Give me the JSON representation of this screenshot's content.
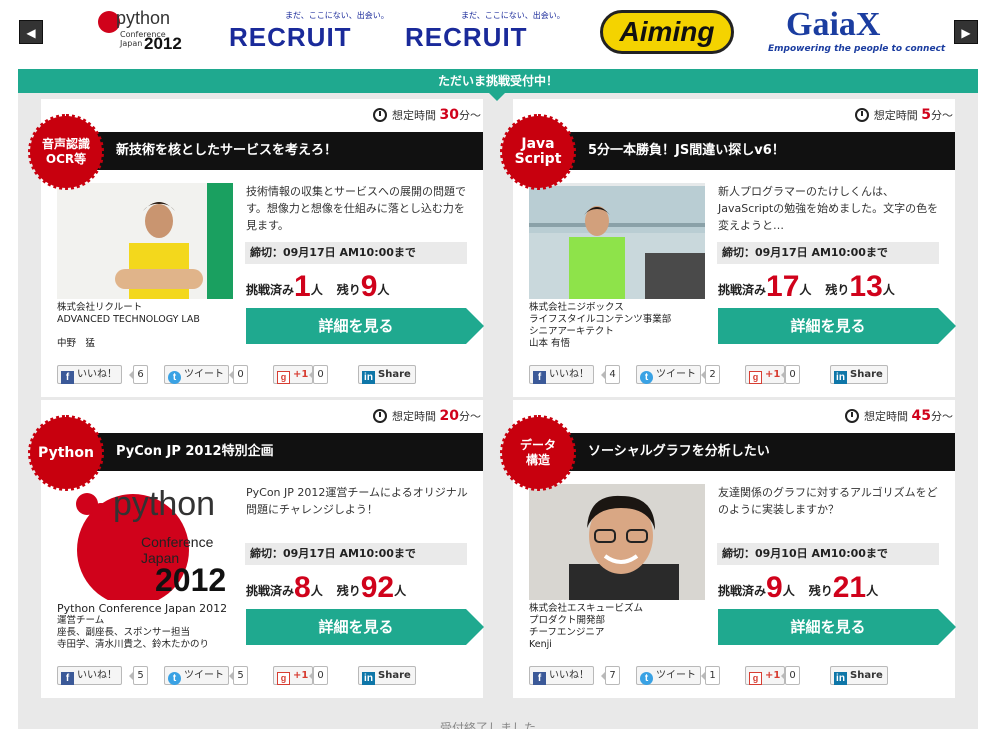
{
  "sponsors": {
    "prev_label": "◀",
    "next_label": "▶",
    "pycon": {
      "word": "python",
      "sub1": "Conference",
      "sub2": "Japan",
      "year": "2012"
    },
    "recruit": {
      "tagline": "まだ、ここにない、出会い。",
      "word": "RECRUIT"
    },
    "aiming": {
      "word": "Aiming"
    },
    "gaiax": {
      "word": "GaiaX",
      "tagline": "Empowering the people to connect"
    }
  },
  "panel": {
    "header": "ただいま挑戦受付中！"
  },
  "labels": {
    "time_prefix": "想定時間",
    "time_unit": "分〜",
    "challenged": "挑戦済み",
    "remaining": "残り",
    "person_unit": "人",
    "detail_button": "詳細を見る",
    "like": "いいね！",
    "tweet": "ツイート",
    "plus_one": "+1",
    "share": "Share"
  },
  "cards": [
    {
      "badge": [
        "音声認識",
        "OCR等"
      ],
      "minutes": "30",
      "title": "新技術を核としたサービスを考えろ！",
      "description": "技術情報の収集とサービスへの展開の問題です。想像力と想像を仕組みに落とし込む力を見ます。",
      "deadline": "締切：09月17日 AM10:00まで",
      "challenged": "1",
      "remaining": "9",
      "company": [
        "株式会社リクルート",
        "ADVANCED TECHNOLOGY LAB",
        "",
        "中野　猛"
      ],
      "likes": "6",
      "tweets": "0",
      "plusones": "0"
    },
    {
      "badge": [
        "Java",
        "Script"
      ],
      "minutes": "5",
      "title": "5分一本勝負！JS間違い探しv6！",
      "description": "新人プログラマーのたけしくんは、JavaScriptの勉強を始めました。文字の色を変えようと…",
      "deadline": "締切：09月17日 AM10:00まで",
      "challenged": "17",
      "remaining": "13",
      "company": [
        "株式会社ニジボックス",
        "ライフスタイルコンテンツ事業部",
        "シニアアーキテクト",
        "山本 有悟"
      ],
      "likes": "4",
      "tweets": "2",
      "plusones": "0"
    },
    {
      "badge": [
        "Python"
      ],
      "minutes": "20",
      "title": "PyCon JP 2012特別企画",
      "description": "PyCon JP 2012運営チームによるオリジナル問題にチャレンジしよう！",
      "deadline": "締切：09月17日 AM10:00まで",
      "challenged": "8",
      "remaining": "92",
      "company": [
        "Python Conference Japan 2012",
        "運営チーム",
        "座長、副座長、スポンサー担当",
        "寺田学、清水川貴之、鈴木たかのり"
      ],
      "likes": "5",
      "tweets": "5",
      "plusones": "0"
    },
    {
      "badge": [
        "データ",
        "構造"
      ],
      "minutes": "45",
      "title": "ソーシャルグラフを分析したい",
      "description": "友達関係のグラフに対するアルゴリズムをどのように実装しますか？",
      "deadline": "締切：09月10日 AM10:00まで",
      "challenged": "9",
      "remaining": "21",
      "company": [
        "株式会社エスキュービズム",
        "プロダクト開発部",
        "チーフエンジニア",
        "Kenji"
      ],
      "likes": "7",
      "tweets": "1",
      "plusones": "0"
    }
  ],
  "footer": {
    "partial_text": "受付終了しました"
  },
  "colors": {
    "accent": "#1fa98f",
    "badge_red": "#c8000e",
    "number_red": "#d0021b"
  }
}
